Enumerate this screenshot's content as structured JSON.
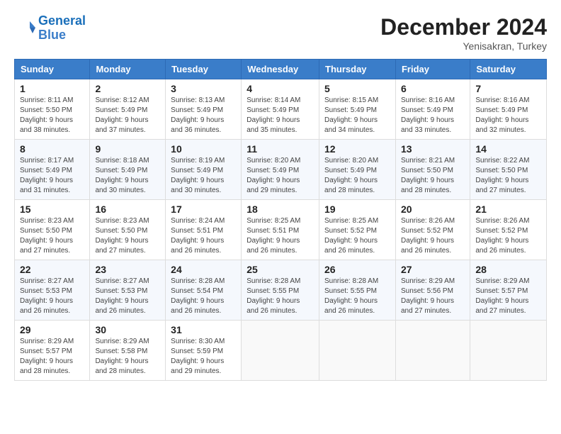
{
  "header": {
    "logo_line1": "General",
    "logo_line2": "Blue",
    "title": "December 2024",
    "subtitle": "Yenisakran, Turkey"
  },
  "days_of_week": [
    "Sunday",
    "Monday",
    "Tuesday",
    "Wednesday",
    "Thursday",
    "Friday",
    "Saturday"
  ],
  "weeks": [
    [
      {
        "day": "1",
        "info": "Sunrise: 8:11 AM\nSunset: 5:50 PM\nDaylight: 9 hours\nand 38 minutes."
      },
      {
        "day": "2",
        "info": "Sunrise: 8:12 AM\nSunset: 5:49 PM\nDaylight: 9 hours\nand 37 minutes."
      },
      {
        "day": "3",
        "info": "Sunrise: 8:13 AM\nSunset: 5:49 PM\nDaylight: 9 hours\nand 36 minutes."
      },
      {
        "day": "4",
        "info": "Sunrise: 8:14 AM\nSunset: 5:49 PM\nDaylight: 9 hours\nand 35 minutes."
      },
      {
        "day": "5",
        "info": "Sunrise: 8:15 AM\nSunset: 5:49 PM\nDaylight: 9 hours\nand 34 minutes."
      },
      {
        "day": "6",
        "info": "Sunrise: 8:16 AM\nSunset: 5:49 PM\nDaylight: 9 hours\nand 33 minutes."
      },
      {
        "day": "7",
        "info": "Sunrise: 8:16 AM\nSunset: 5:49 PM\nDaylight: 9 hours\nand 32 minutes."
      }
    ],
    [
      {
        "day": "8",
        "info": "Sunrise: 8:17 AM\nSunset: 5:49 PM\nDaylight: 9 hours\nand 31 minutes."
      },
      {
        "day": "9",
        "info": "Sunrise: 8:18 AM\nSunset: 5:49 PM\nDaylight: 9 hours\nand 30 minutes."
      },
      {
        "day": "10",
        "info": "Sunrise: 8:19 AM\nSunset: 5:49 PM\nDaylight: 9 hours\nand 30 minutes."
      },
      {
        "day": "11",
        "info": "Sunrise: 8:20 AM\nSunset: 5:49 PM\nDaylight: 9 hours\nand 29 minutes."
      },
      {
        "day": "12",
        "info": "Sunrise: 8:20 AM\nSunset: 5:49 PM\nDaylight: 9 hours\nand 28 minutes."
      },
      {
        "day": "13",
        "info": "Sunrise: 8:21 AM\nSunset: 5:50 PM\nDaylight: 9 hours\nand 28 minutes."
      },
      {
        "day": "14",
        "info": "Sunrise: 8:22 AM\nSunset: 5:50 PM\nDaylight: 9 hours\nand 27 minutes."
      }
    ],
    [
      {
        "day": "15",
        "info": "Sunrise: 8:23 AM\nSunset: 5:50 PM\nDaylight: 9 hours\nand 27 minutes."
      },
      {
        "day": "16",
        "info": "Sunrise: 8:23 AM\nSunset: 5:50 PM\nDaylight: 9 hours\nand 27 minutes."
      },
      {
        "day": "17",
        "info": "Sunrise: 8:24 AM\nSunset: 5:51 PM\nDaylight: 9 hours\nand 26 minutes."
      },
      {
        "day": "18",
        "info": "Sunrise: 8:25 AM\nSunset: 5:51 PM\nDaylight: 9 hours\nand 26 minutes."
      },
      {
        "day": "19",
        "info": "Sunrise: 8:25 AM\nSunset: 5:52 PM\nDaylight: 9 hours\nand 26 minutes."
      },
      {
        "day": "20",
        "info": "Sunrise: 8:26 AM\nSunset: 5:52 PM\nDaylight: 9 hours\nand 26 minutes."
      },
      {
        "day": "21",
        "info": "Sunrise: 8:26 AM\nSunset: 5:52 PM\nDaylight: 9 hours\nand 26 minutes."
      }
    ],
    [
      {
        "day": "22",
        "info": "Sunrise: 8:27 AM\nSunset: 5:53 PM\nDaylight: 9 hours\nand 26 minutes."
      },
      {
        "day": "23",
        "info": "Sunrise: 8:27 AM\nSunset: 5:53 PM\nDaylight: 9 hours\nand 26 minutes."
      },
      {
        "day": "24",
        "info": "Sunrise: 8:28 AM\nSunset: 5:54 PM\nDaylight: 9 hours\nand 26 minutes."
      },
      {
        "day": "25",
        "info": "Sunrise: 8:28 AM\nSunset: 5:55 PM\nDaylight: 9 hours\nand 26 minutes."
      },
      {
        "day": "26",
        "info": "Sunrise: 8:28 AM\nSunset: 5:55 PM\nDaylight: 9 hours\nand 26 minutes."
      },
      {
        "day": "27",
        "info": "Sunrise: 8:29 AM\nSunset: 5:56 PM\nDaylight: 9 hours\nand 27 minutes."
      },
      {
        "day": "28",
        "info": "Sunrise: 8:29 AM\nSunset: 5:57 PM\nDaylight: 9 hours\nand 27 minutes."
      }
    ],
    [
      {
        "day": "29",
        "info": "Sunrise: 8:29 AM\nSunset: 5:57 PM\nDaylight: 9 hours\nand 28 minutes."
      },
      {
        "day": "30",
        "info": "Sunrise: 8:29 AM\nSunset: 5:58 PM\nDaylight: 9 hours\nand 28 minutes."
      },
      {
        "day": "31",
        "info": "Sunrise: 8:30 AM\nSunset: 5:59 PM\nDaylight: 9 hours\nand 29 minutes."
      },
      {
        "day": "",
        "info": ""
      },
      {
        "day": "",
        "info": ""
      },
      {
        "day": "",
        "info": ""
      },
      {
        "day": "",
        "info": ""
      }
    ]
  ]
}
